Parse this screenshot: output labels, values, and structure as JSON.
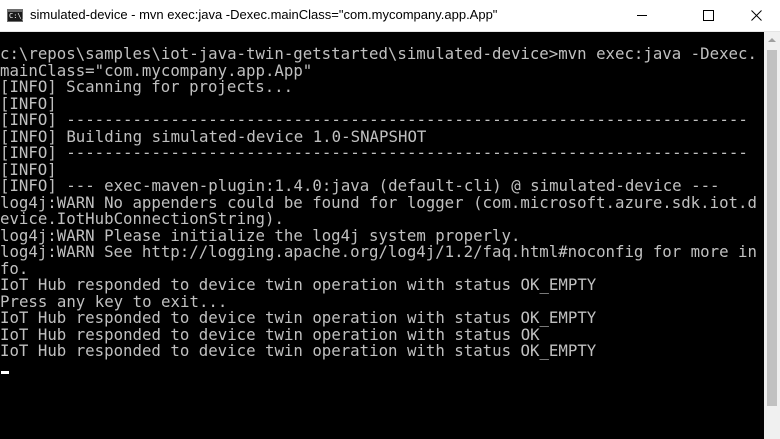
{
  "window": {
    "title": "simulated-device - mvn  exec:java -Dexec.mainClass=\"com.mycompany.app.App\"",
    "icon_text": "C:\\_"
  },
  "console": {
    "lines": [
      "c:\\repos\\samples\\iot-java-twin-getstarted\\simulated-device>mvn exec:java -Dexec.",
      "mainClass=\"com.mycompany.app.App\"",
      "[INFO] Scanning for projects...",
      "[INFO]",
      "[INFO] ------------------------------------------------------------------------",
      "[INFO] Building simulated-device 1.0-SNAPSHOT",
      "[INFO] ------------------------------------------------------------------------",
      "[INFO]",
      "[INFO] --- exec-maven-plugin:1.4.0:java (default-cli) @ simulated-device ---",
      "log4j:WARN No appenders could be found for logger (com.microsoft.azure.sdk.iot.d",
      "evice.IotHubConnectionString).",
      "log4j:WARN Please initialize the log4j system properly.",
      "log4j:WARN See http://logging.apache.org/log4j/1.2/faq.html#noconfig for more in",
      "fo.",
      "IoT Hub responded to device twin operation with status OK_EMPTY",
      "Press any key to exit...",
      "IoT Hub responded to device twin operation with status OK_EMPTY",
      "IoT Hub responded to device twin operation with status OK",
      "IoT Hub responded to device twin operation with status OK_EMPTY"
    ]
  },
  "colors": {
    "console_bg": "#000000",
    "console_fg": "#c0c0c0",
    "titlebar_bg": "#ffffff",
    "scrollbar_bg": "#f0f0f0",
    "scrollbar_thumb": "#c1c1c1"
  }
}
